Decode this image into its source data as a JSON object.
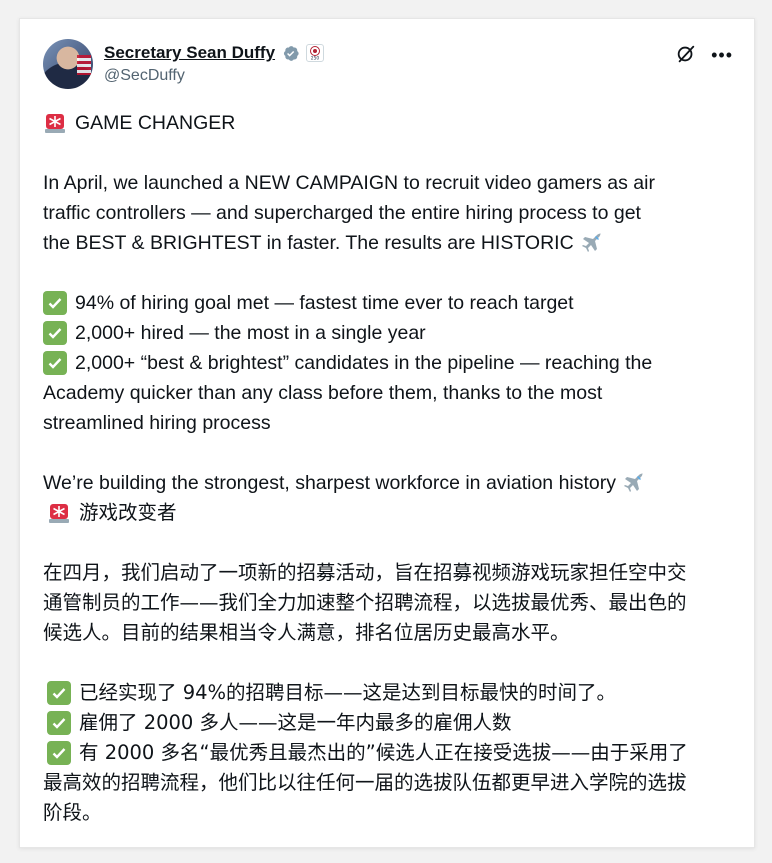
{
  "author": {
    "name": "Secretary Sean Duffy",
    "handle": "@SecDuffy",
    "affiliate_badge": "250"
  },
  "icons": {
    "verified": "verified-badge-icon",
    "affiliate": "affiliate-badge-icon",
    "grok": "grok-icon",
    "more": "more-icon",
    "siren": "siren-emoji",
    "airplane": "airplane-emoji",
    "check": "check-mark-emoji"
  },
  "colors": {
    "verified": "#829aab",
    "check_bg": "#77b255",
    "siren": "#dd2e44",
    "text": "#0f1419",
    "muted": "#536471"
  },
  "post": {
    "headline": "GAME CHANGER",
    "para1": [
      "In April, we launched a NEW CAMPAIGN to recruit video gamers as air",
      "traffic controllers — and supercharged the entire hiring process to get",
      "the BEST & BRIGHTEST in faster. The results are HISTORIC"
    ],
    "bullet1": "94% of hiring goal met — fastest time ever to reach target",
    "bullet2": "2,000+ hired — the most in a single year",
    "bullet3_lines": [
      "2,000+ “best & brightest” candidates in the pipeline — reaching the",
      "Academy quicker than any class before them, thanks to the most",
      "streamlined hiring process"
    ],
    "closing": "We’re building the strongest, sharpest workforce in aviation history",
    "zh_headline": "游戏改变者",
    "zh_para": [
      "在四月，我们启动了一项新的招募活动，旨在招募视频游戏玩家担任空中交",
      "通管制员的工作——我们全力加速整个招聘流程，以选拔最优秀、最出色的",
      "候选人。目前的结果相当令人满意，排名位居历史最高水平。"
    ],
    "zh_bullet1": "已经实现了 94%的招聘目标——这是达到目标最快的时间了。",
    "zh_bullet2": "雇佣了 2000 多人——这是一年内最多的雇佣人数",
    "zh_bullet3_lines": [
      "有 2000 多名“最优秀且最杰出的”候选人正在接受选拔——由于采用了",
      "最高效的招聘流程，他们比以往任何一届的选拔队伍都更早进入学院的选拔",
      "阶段。"
    ]
  }
}
